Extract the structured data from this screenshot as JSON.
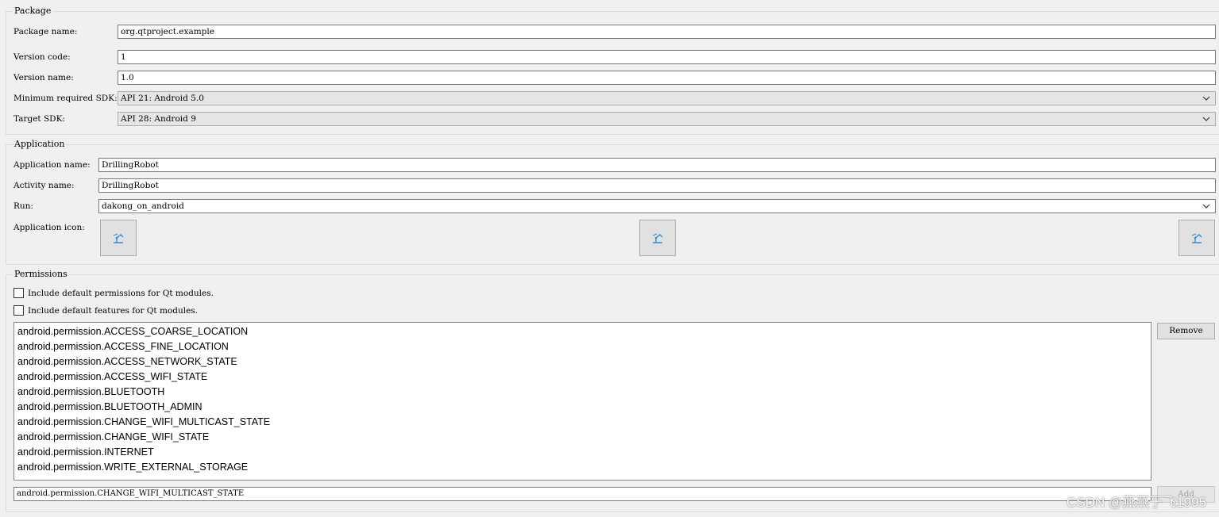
{
  "package": {
    "title": "Package",
    "name_label": "Package name:",
    "name_value": "org.qtproject.example",
    "version_code_label": "Version code:",
    "version_code_value": "1",
    "version_name_label": "Version name:",
    "version_name_value": "1.0",
    "min_sdk_label": "Minimum required SDK:",
    "min_sdk_value": "API 21: Android 5.0",
    "target_sdk_label": "Target SDK:",
    "target_sdk_value": "API 28: Android 9"
  },
  "application": {
    "title": "Application",
    "app_name_label": "Application name:",
    "app_name_value": "DrillingRobot",
    "activity_name_label": "Activity name:",
    "activity_name_value": "DrillingRobot",
    "run_label": "Run:",
    "run_value": "dakong_on_android",
    "icon_label": "Application icon:"
  },
  "permissions": {
    "title": "Permissions",
    "include_permissions_label": "Include default permissions for Qt modules.",
    "include_features_label": "Include default features for Qt modules.",
    "list": [
      "android.permission.ACCESS_COARSE_LOCATION",
      "android.permission.ACCESS_FINE_LOCATION",
      "android.permission.ACCESS_NETWORK_STATE",
      "android.permission.ACCESS_WIFI_STATE",
      "android.permission.BLUETOOTH",
      "android.permission.BLUETOOTH_ADMIN",
      "android.permission.CHANGE_WIFI_MULTICAST_STATE",
      "android.permission.CHANGE_WIFI_STATE",
      "android.permission.INTERNET",
      "android.permission.WRITE_EXTERNAL_STORAGE"
    ],
    "remove_label": "Remove",
    "add_label": "Add",
    "new_permission_value": "android.permission.CHANGE_WIFI_MULTICAST_STATE"
  },
  "watermark": "CSDN @燕燕于飞1995",
  "icons": {
    "app_icon": "robot-arm-icon",
    "dropdown": "chevron-down-icon"
  }
}
